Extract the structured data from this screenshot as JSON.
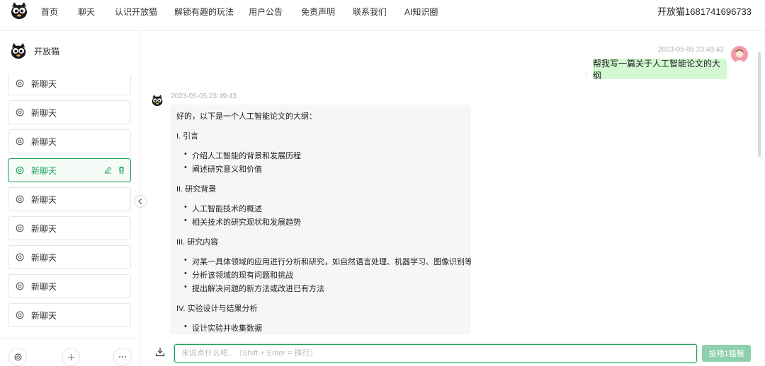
{
  "nav": {
    "logo_icon": "cat-logo-icon",
    "items": [
      "首页",
      "聊天",
      "认识开放猫",
      "解锁有趣的玩法",
      "用户公告",
      "免责声明",
      "联系我们",
      "AI知识圈"
    ],
    "account": "开放猫1681741696733"
  },
  "sidebar": {
    "brand": "开放猫",
    "chats": [
      {
        "label": "新聊天",
        "active": false
      },
      {
        "label": "新聊天",
        "active": false
      },
      {
        "label": "新聊天",
        "active": false
      },
      {
        "label": "新聊天",
        "active": true
      },
      {
        "label": "新聊天",
        "active": false
      },
      {
        "label": "新聊天",
        "active": false
      },
      {
        "label": "新聊天",
        "active": false
      },
      {
        "label": "新聊天",
        "active": false
      },
      {
        "label": "新聊天",
        "active": false
      }
    ],
    "item_icon": "openai-icon",
    "footer_icons": [
      "openai-icon",
      "plus-icon",
      "more-icon"
    ]
  },
  "conversation": {
    "user_message": {
      "time": "2023-05-05 23:49:43",
      "text": "帮我写一篇关于人工智能论文的大纲"
    },
    "bot_message": {
      "time": "2023-05-05 23:49:43",
      "lines": [
        {
          "text": "好的，以下是一个人工智能论文的大纲：",
          "bullet": false
        },
        {
          "text": "I. 引言",
          "bullet": false
        },
        {
          "text": "介绍人工智能的背景和发展历程",
          "bullet": true
        },
        {
          "text": "阐述研究意义和价值",
          "bullet": true
        },
        {
          "text": "II. 研究背景",
          "bullet": false
        },
        {
          "text": "人工智能技术的概述",
          "bullet": true
        },
        {
          "text": "相关技术的研究现状和发展趋势",
          "bullet": true
        },
        {
          "text": "III. 研究内容",
          "bullet": false
        },
        {
          "text": "对某一具体领域的应用进行分析和研究，如自然语言处理、机器学习、图像识别等",
          "bullet": true
        },
        {
          "text": "分析该领域的现有问题和挑战",
          "bullet": true
        },
        {
          "text": "提出解决问题的新方法或改进已有方法",
          "bullet": true
        },
        {
          "text": "IV. 实验设计与结果分析",
          "bullet": false
        },
        {
          "text": "设计实验并收集数据",
          "bullet": true
        }
      ]
    }
  },
  "composer": {
    "placeholder": "来说点什么吧...（Shift + Enter = 换行）",
    "send_label": "投喂1猫粮"
  },
  "colors": {
    "accent": "#18a058",
    "user_bubble": "#d2f9d1",
    "bot_bubble": "#f4f6f8",
    "send_disabled": "#8ed0ab"
  }
}
